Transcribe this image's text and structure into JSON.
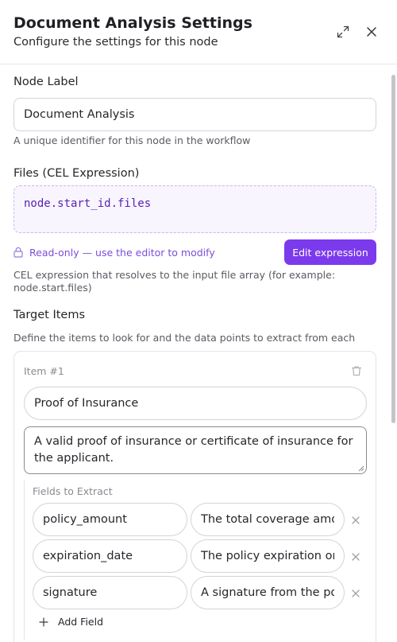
{
  "header": {
    "title": "Document Analysis Settings",
    "subtitle": "Configure the settings for this node"
  },
  "node_label": {
    "label": "Node Label",
    "value": "Document Analysis",
    "help": "A unique identifier for this node in the workflow"
  },
  "files": {
    "label": "Files (CEL Expression)",
    "expression": "node.start_id.files",
    "readonly_note": "Read-only — use the editor to modify",
    "edit_button": "Edit expression",
    "help_line1": "CEL expression that resolves to the input file array (for example:",
    "help_line2": "node.start.files)"
  },
  "target_items": {
    "label": "Target Items",
    "help": "Define the items to look for and the data points to extract from each",
    "items": [
      {
        "number_label": "Item #1",
        "name": "Proof of Insurance",
        "description": "A valid proof of insurance or certificate of insurance for the applicant.",
        "fields_label": "Fields to Extract",
        "fields": [
          {
            "name": "policy_amount",
            "description": "The total coverage amount"
          },
          {
            "name": "expiration_date",
            "description": "The policy expiration or renewal date"
          },
          {
            "name": "signature",
            "description": "A signature from the policy holder"
          }
        ],
        "add_field": "Add Field"
      }
    ]
  },
  "icons": {
    "expand": "expand-icon",
    "close": "close-icon",
    "lock": "lock-icon",
    "trash": "trash-icon",
    "remove": "x-icon",
    "add": "plus-icon"
  },
  "colors": {
    "accent": "#7c3aed",
    "code_text": "#5b21b6",
    "readonly_text": "#7c4ddb",
    "cel_background": "#f8f5fe"
  }
}
